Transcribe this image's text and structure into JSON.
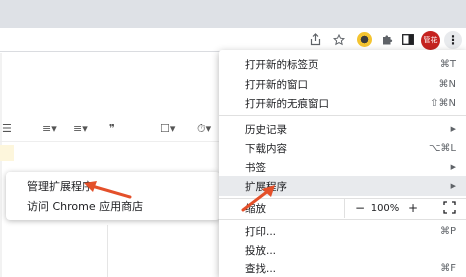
{
  "toolbar": {
    "icons": [
      "share-icon",
      "star-icon",
      "extension-icon",
      "puzzle-icon",
      "sidepanel-icon"
    ],
    "profile_badge": "管花",
    "menu_button": "⋮"
  },
  "doc_toolbar": {
    "items": [
      "☰",
      "≡▾",
      "≡▾",
      "❞",
      "☐▾",
      "⏱▾"
    ]
  },
  "menu": {
    "items": [
      {
        "label": "打开新的标签页",
        "shortcut": "⌘T"
      },
      {
        "label": "打开新的窗口",
        "shortcut": "⌘N"
      },
      {
        "label": "打开新的无痕窗口",
        "shortcut": "⇧⌘N"
      },
      {
        "label": "历史记录",
        "arrow": "▶"
      },
      {
        "label": "下载内容",
        "shortcut": "⌥⌘L"
      },
      {
        "label": "书签",
        "arrow": "▶"
      },
      {
        "label": "扩展程序",
        "arrow": "▶"
      },
      {
        "label": "缩放"
      },
      {
        "label": "打印...",
        "shortcut": "⌘P"
      },
      {
        "label": "投放..."
      },
      {
        "label": "查找...",
        "shortcut": "⌘F"
      }
    ],
    "zoom": {
      "minus": "−",
      "level": "100%",
      "plus": "+"
    }
  },
  "submenu": {
    "items": [
      {
        "label": "管理扩展程序"
      },
      {
        "label": "访问 Chrome 应用商店"
      }
    ]
  },
  "colors": {
    "annotation_arrow": "#e4502a",
    "highlight": "#e8eaed",
    "profile_badge": "#c5221f"
  }
}
